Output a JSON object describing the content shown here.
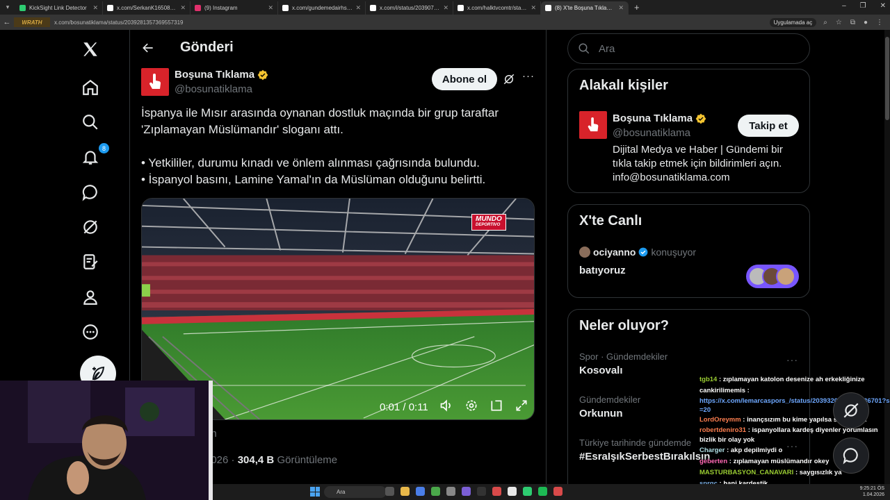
{
  "browser": {
    "tabs": [
      {
        "label": "KickSight Link Detector",
        "color": "#2ecc71"
      },
      {
        "label": "x.com/SerkanK16508934/statu",
        "color": "#000000"
      },
      {
        "label": "(9) Instagram",
        "color": "#e1306c"
      },
      {
        "label": "x.com/gundemedairhs/status/2",
        "color": "#000000"
      },
      {
        "label": "x.com/i/status/2039078403228",
        "color": "#000000"
      },
      {
        "label": "x.com/halktvcomtr/status/20391",
        "color": "#000000"
      },
      {
        "label": "(8) X'te Boşuna Tıklama: \"İspan",
        "color": "#000000"
      }
    ],
    "url": "x.com/bosunatiklama/status/2039281357369557319",
    "extension_badge": "WRATH",
    "app_button": "Uygulamada aç"
  },
  "header": {
    "title": "Gönderi"
  },
  "nav": {
    "notification_count": "8"
  },
  "tweet": {
    "display_name": "Boşuna Tıklama",
    "handle": "@bosunatiklama",
    "subscribe_label": "Abone ol",
    "text": "İspanya ile Mısır arasında oynanan dostluk maçında bir grup taraftar 'Zıplamayan Müslümandır' sloganı attı.\n\n• Yetkililer, durumu kınadı ve önlem alınması çağrısında bulundu.\n• İspanyol basını, Lamine Yamal'ın da Müslüman olduğunu belirtti.",
    "video_time": "0:01 / 0:11",
    "video_progress": 0.09,
    "watermark_line1": "MUNDO",
    "watermark_line2": "DEPORTIVO",
    "below_fragment": "an",
    "date_fragment": "2026 ·",
    "views_value": "304,4 B",
    "views_label": "Görüntüleme"
  },
  "search": {
    "placeholder": "Ara"
  },
  "related": {
    "title": "Alakalı kişiler",
    "name": "Boşuna Tıklama",
    "handle": "@bosunatiklama",
    "follow_label": "Takip et",
    "bio": "Dijital Medya ve Haber | Gündemi bir tıkla takip etmek için bildirimleri açın. info@bosunatiklama.com"
  },
  "live": {
    "title": "X'te Canlı",
    "user": "ociyanno",
    "status": "konuşuyor",
    "text": "batıyoruz"
  },
  "trends": {
    "title": "Neler oluyor?",
    "items": [
      {
        "category": "Spor · Gündemdekiler",
        "name": "Kosovalı"
      },
      {
        "category": "Gündemdekiler",
        "name": "Orkunun"
      },
      {
        "category": "Türkiye tarihinde gündemde",
        "name": "#EsraIşıkSerbestBırakılsın"
      }
    ]
  },
  "chat": [
    {
      "user": "tgb14",
      "text": ": zıplamayan katolon desenize ah erkekliğinize"
    },
    {
      "user": "cankirilimemis",
      "text": ":"
    },
    {
      "user": "",
      "text": "https://x.com/lemarcaspors_/status/2039320430065536701?s=20"
    },
    {
      "user": "LordOreymm",
      "text": ": inançsızım bu kime yapılsa saygısızlık"
    },
    {
      "user": "robertdeniro31",
      "text": ": ispanyollara kardeş diyenler yorumlasın bizlik bir olay yok"
    },
    {
      "user": "Charger",
      "text": ": akp depilmiydi o"
    },
    {
      "user": "geberten",
      "text": ": zıplamayan müslümandır okey"
    },
    {
      "user": "MASTURBASYON_CANAVARI",
      "text": ": saygısızlık ya"
    },
    {
      "user": "sprgc",
      "text": ": hani kardeştik"
    }
  ],
  "taskbar": {
    "search": "Ara",
    "time": "9:25:21 ÖS",
    "date": "1.04.2026"
  },
  "colors": {
    "accent": "#1d9bf0",
    "brand_red": "#d8232a",
    "verified": "#f4c430",
    "spaces": "#7856ff"
  }
}
